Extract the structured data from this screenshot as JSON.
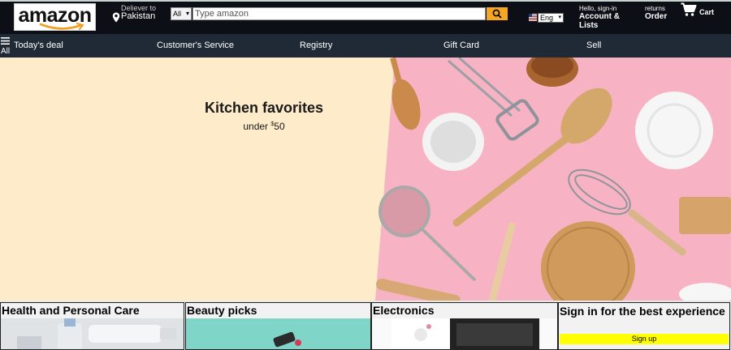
{
  "header": {
    "logo_text": "amazon",
    "deliver_label": "Deliever to",
    "deliver_location": "Pakistan",
    "search_category": "All",
    "search_placeholder": "Type amazon",
    "language": "Eng",
    "account_greeting": "Hello, sign-in",
    "account_main": "Account & Lists",
    "returns_label": "returns",
    "orders_label": "Order",
    "cart_label": "Cart"
  },
  "subnav": {
    "all_label": "All",
    "items": [
      "Today's deal",
      "Customer's Service",
      "Registry",
      "Gift Card",
      "Sell"
    ]
  },
  "hero": {
    "title": "Kitchen favorites",
    "subtitle_prefix": "under ",
    "subtitle_currency": "$",
    "subtitle_amount": "50"
  },
  "cards": [
    {
      "title": "Health and Personal Care"
    },
    {
      "title": "Beauty picks"
    },
    {
      "title": "Electronics"
    }
  ],
  "signin_card": {
    "title": "Sign in for the best experience",
    "button_label": "Sign up"
  },
  "colors": {
    "header_bg": "#0c1016",
    "subnav_bg": "#1f2a36",
    "search_button": "#f5a623",
    "hero_left_bg": "#fdebc9",
    "hero_right_bg": "#f7b3c4",
    "signup_button": "#ffff00"
  },
  "icons": {
    "search": "search-icon",
    "location": "location-pin-icon",
    "cart": "cart-icon",
    "menu": "hamburger-icon",
    "flag": "flag-icon"
  }
}
